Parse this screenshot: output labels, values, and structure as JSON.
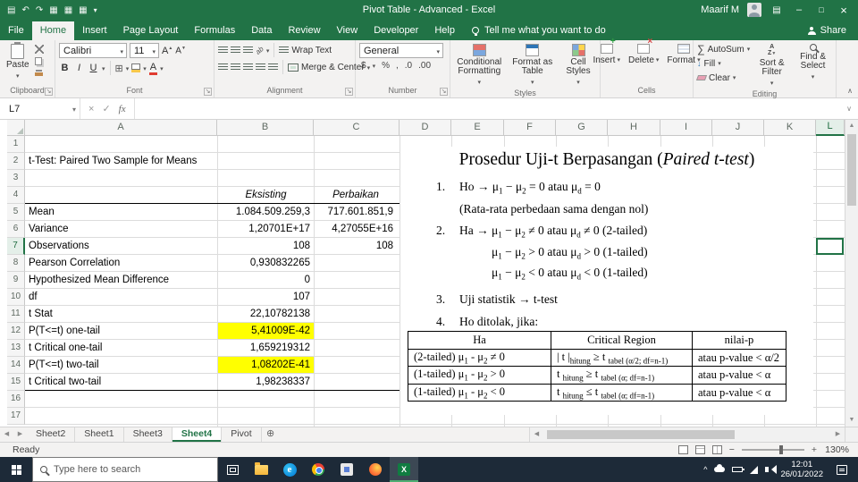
{
  "titlebar": {
    "title": "Pivot Table - Advanced  -  Excel",
    "user": "Maarif M"
  },
  "menubar": {
    "tabs": [
      "File",
      "Home",
      "Insert",
      "Page Layout",
      "Formulas",
      "Data",
      "Review",
      "View",
      "Developer",
      "Help"
    ],
    "active_tab": "Home",
    "tell_me": "Tell me what you want to do",
    "share": "Share"
  },
  "ribbon": {
    "groups": [
      "Clipboard",
      "Font",
      "Alignment",
      "Number",
      "Styles",
      "Cells",
      "Editing"
    ],
    "paste": "Paste",
    "font_name": "Calibri",
    "font_size": "11",
    "bold": "B",
    "italic": "I",
    "underline": "U",
    "wrap_text": "Wrap Text",
    "merge_center": "Merge & Center",
    "number_format": "General",
    "num_icons": [
      "$",
      "%",
      ",",
      ".0",
      ".00"
    ],
    "styles": [
      "Conditional Formatting",
      "Format as Table",
      "Cell Styles"
    ],
    "cells": [
      "Insert",
      "Delete",
      "Format"
    ],
    "editing": [
      "AutoSum",
      "Fill",
      "Clear",
      "Sort & Filter",
      "Find & Select"
    ]
  },
  "formula_bar": {
    "name_box": "L7",
    "fx": "fx",
    "formula": ""
  },
  "sheet": {
    "columns": [
      "A",
      "B",
      "C",
      "D",
      "E",
      "F",
      "G",
      "H",
      "I",
      "J",
      "K",
      "L"
    ],
    "row_numbers": [
      "1",
      "2",
      "3",
      "4",
      "5",
      "6",
      "7",
      "8",
      "9",
      "10",
      "11",
      "12",
      "13",
      "14",
      "15",
      "16",
      "17"
    ],
    "selection": "L7",
    "title_cell": "t-Test: Paired Two Sample for Means",
    "col1_header": "Eksisting",
    "col2_header": "Perbaikan",
    "rows": [
      {
        "label": "Mean",
        "v1": "1.084.509.259,3",
        "v2": "717.601.851,9"
      },
      {
        "label": "Variance",
        "v1": "1,20701E+17",
        "v2": "4,27055E+16"
      },
      {
        "label": "Observations",
        "v1": "108",
        "v2": "108"
      },
      {
        "label": "Pearson Correlation",
        "v1": "0,930832265"
      },
      {
        "label": "Hypothesized Mean Difference",
        "v1": "0"
      },
      {
        "label": "df",
        "v1": "107"
      },
      {
        "label": "t Stat",
        "v1": "22,10782138"
      },
      {
        "label": "P(T<=t) one-tail",
        "v1": "5,41009E-42"
      },
      {
        "label": "t Critical one-tail",
        "v1": "1,659219312"
      },
      {
        "label": "P(T<=t) two-tail",
        "v1": "1,08202E-41"
      },
      {
        "label": "t Critical two-tail",
        "v1": "1,98238337"
      }
    ]
  },
  "doc": {
    "title": "Prosedur Uji-t Berpasangan (<i>Paired t-test</i>)",
    "i1n": "1.",
    "i1a": "Ho → μ<sub>1</sub> − μ<sub>2</sub> = 0 atau μ<sub>d</sub> = 0",
    "i1b": "(Rata-rata perbedaan sama dengan nol)",
    "i2n": "2.",
    "i2a": "Ha → μ<sub>1</sub> − μ<sub>2</sub> ≠ 0 atau μ<sub>d</sub> ≠ 0 (2-tailed)",
    "i2b": "μ<sub>1</sub> − μ<sub>2</sub> > 0 atau μ<sub>d</sub> > 0 (1-tailed)",
    "i2c": "μ<sub>1</sub> − μ<sub>2</sub> < 0 atau μ<sub>d</sub> < 0 (1-tailed)",
    "i3n": "3.",
    "i3a": "Uji statistik → t-test",
    "i4n": "4.",
    "i4a": "Ho ditolak, jika:",
    "table": {
      "headers": [
        "Ha",
        "Critical Region",
        "nilai-p"
      ],
      "rows": [
        [
          "(2-tailed) μ<sub>1</sub> - μ<sub>2</sub> ≠ 0",
          "| t |<sub>hitung</sub> ≥ t <sub>tabel (α/2; df=n-1)</sub>",
          "atau p-value < α/2"
        ],
        [
          "(1-tailed) μ<sub>1</sub> - μ<sub>2</sub> > 0",
          "t <sub>hitung</sub> ≥ t <sub>tabel (α; df=n-1)</sub>",
          "atau p-value < α"
        ],
        [
          "(1-tailed) μ<sub>1</sub> - μ<sub>2</sub> < 0",
          "t <sub>hitung</sub> ≤ t <sub>tabel (α; df=n-1)</sub>",
          "atau p-value < α"
        ]
      ]
    }
  },
  "sheet_tabs": {
    "names": [
      "Sheet2",
      "Sheet1",
      "Sheet3",
      "Sheet4",
      "Pivot"
    ],
    "active": "Sheet4"
  },
  "status_bar": {
    "mode": "Ready",
    "zoom": "130%"
  },
  "taskbar": {
    "search_placeholder": "Type here to search",
    "time": "12:01",
    "date": "26/01/2022"
  },
  "icons": {
    "note": "semantic icon names are carried on data-name attributes; glyphs/shapes rendered via CSS"
  }
}
